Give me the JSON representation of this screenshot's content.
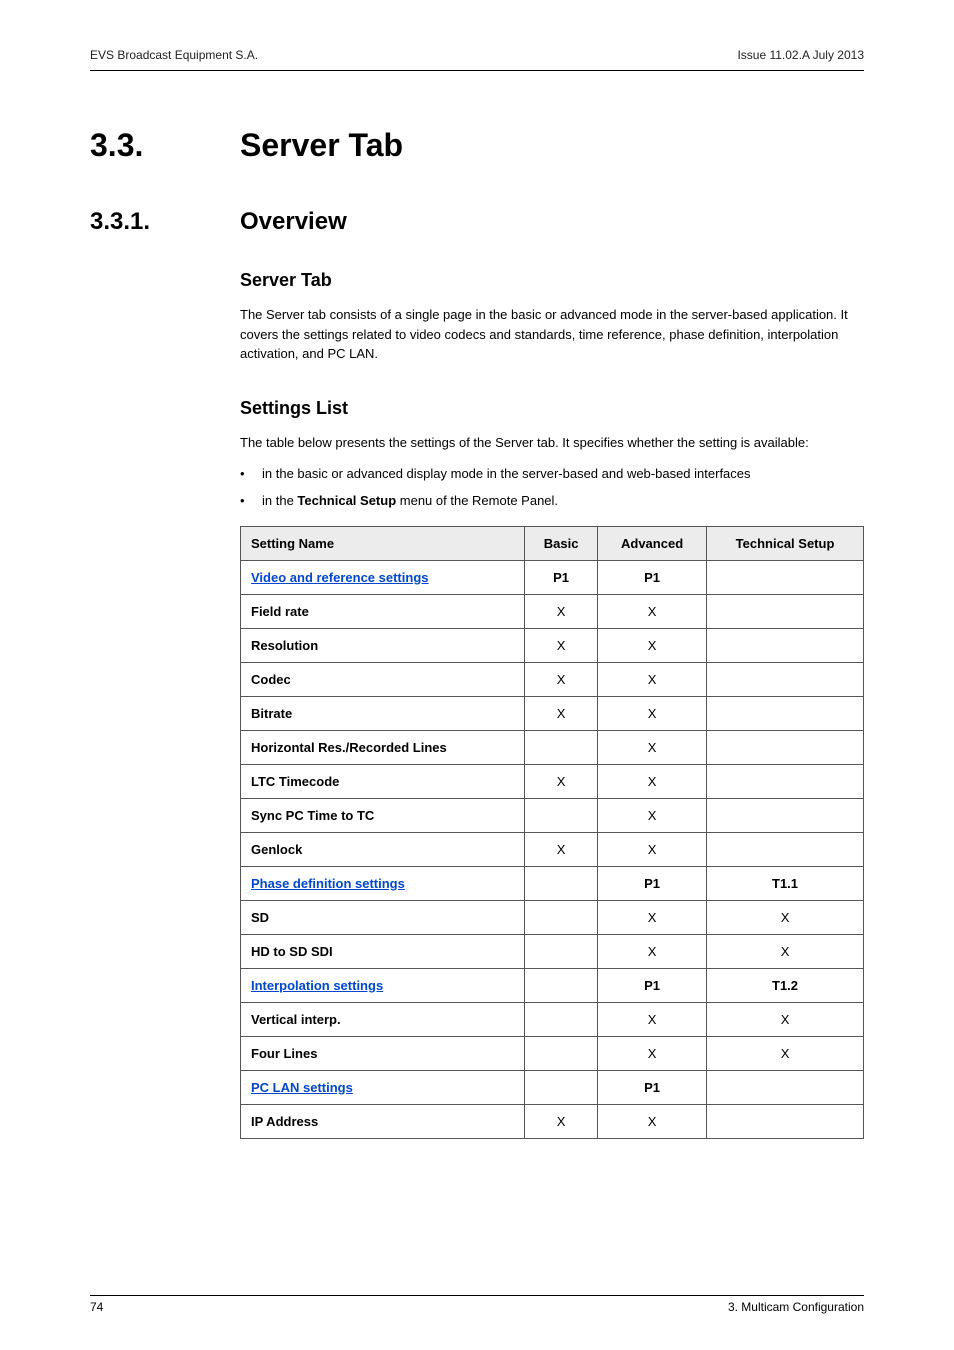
{
  "header": {
    "left": "EVS Broadcast Equipment S.A.",
    "right": "Issue 11.02.A  July 2013"
  },
  "h1": {
    "num": "3.3.",
    "title": "Server Tab"
  },
  "h2": {
    "num": "3.3.1.",
    "title": "Overview"
  },
  "section1": {
    "heading": "Server Tab",
    "para": "The Server tab consists of a single page in the basic or advanced mode in the server-based application. It covers the settings related to video codecs and standards, time reference, phase definition, interpolation activation, and PC LAN."
  },
  "section2": {
    "heading": "Settings List",
    "para": "The table below presents the settings of the Server tab. It specifies whether the setting is available:",
    "bullets": [
      "in the basic or advanced display mode in the server-based and web-based interfaces",
      "in the Technical Setup menu of the Remote Panel."
    ],
    "bullet2_prefix": "in the ",
    "bullet2_bold": "Technical Setup",
    "bullet2_suffix": " menu of the Remote Panel."
  },
  "table": {
    "headers": [
      "Setting Name",
      "Basic",
      "Advanced",
      "Technical Setup"
    ],
    "rows": [
      {
        "section": true,
        "cells": [
          "Video and reference settings",
          "P1",
          "P1",
          ""
        ]
      },
      {
        "section": false,
        "cells": [
          "Field rate",
          "X",
          "X",
          ""
        ]
      },
      {
        "section": false,
        "cells": [
          "Resolution",
          "X",
          "X",
          ""
        ]
      },
      {
        "section": false,
        "cells": [
          "Codec",
          "X",
          "X",
          ""
        ]
      },
      {
        "section": false,
        "cells": [
          "Bitrate",
          "X",
          "X",
          ""
        ]
      },
      {
        "section": false,
        "cells": [
          "Horizontal Res./Recorded Lines",
          "",
          "X",
          ""
        ]
      },
      {
        "section": false,
        "cells": [
          "LTC Timecode",
          "X",
          "X",
          ""
        ]
      },
      {
        "section": false,
        "cells": [
          "Sync PC Time to TC",
          "",
          "X",
          ""
        ]
      },
      {
        "section": false,
        "cells": [
          "Genlock",
          "X",
          "X",
          ""
        ]
      },
      {
        "section": true,
        "cells": [
          "Phase definition settings",
          "",
          "P1",
          "T1.1"
        ]
      },
      {
        "section": false,
        "cells": [
          "SD",
          "",
          "X",
          "X"
        ]
      },
      {
        "section": false,
        "cells": [
          "HD to SD SDI",
          "",
          "X",
          "X"
        ]
      },
      {
        "section": true,
        "cells": [
          "Interpolation settings",
          "",
          "P1",
          "T1.2"
        ]
      },
      {
        "section": false,
        "cells": [
          "Vertical interp.",
          "",
          "X",
          "X"
        ]
      },
      {
        "section": false,
        "cells": [
          "Four Lines",
          "",
          "X",
          "X"
        ]
      },
      {
        "section": true,
        "cells": [
          "PC LAN settings",
          "",
          "P1",
          ""
        ]
      },
      {
        "section": false,
        "cells": [
          "IP Address",
          "X",
          "X",
          ""
        ]
      }
    ]
  },
  "footer": {
    "left": "74",
    "right": "3. Multicam Configuration"
  }
}
